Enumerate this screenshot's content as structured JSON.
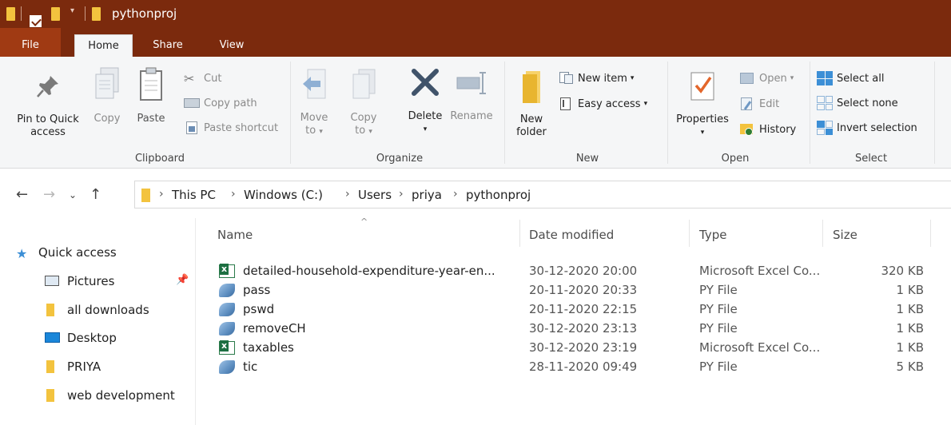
{
  "window": {
    "title": "pythonproj"
  },
  "ribbon_tabs": {
    "file": "File",
    "home": "Home",
    "share": "Share",
    "view": "View"
  },
  "clipboard": {
    "pin_label": "Pin to Quick access",
    "pin_line1": "Pin to Quick",
    "pin_line2": "access",
    "copy": "Copy",
    "paste": "Paste",
    "cut": "Cut",
    "copy_path": "Copy path",
    "paste_shortcut": "Paste shortcut",
    "group": "Clipboard"
  },
  "organize": {
    "move_to_1": "Move",
    "move_to_2": "to",
    "copy_to_1": "Copy",
    "copy_to_2": "to",
    "delete": "Delete",
    "rename": "Rename",
    "group": "Organize"
  },
  "new": {
    "folder_1": "New",
    "folder_2": "folder",
    "new_item": "New item",
    "easy_access": "Easy access",
    "group": "New"
  },
  "open": {
    "properties": "Properties",
    "open": "Open",
    "edit": "Edit",
    "history": "History",
    "group": "Open"
  },
  "select": {
    "select_all": "Select all",
    "select_none": "Select none",
    "invert": "Invert selection",
    "group": "Select"
  },
  "breadcrumb": [
    "This PC",
    "Windows (C:)",
    "Users",
    "priya",
    "pythonproj"
  ],
  "navpane": {
    "quick_access": "Quick access",
    "items": [
      "Pictures",
      "all downloads",
      "Desktop",
      "PRIYA",
      "web development"
    ]
  },
  "columns": {
    "name": "Name",
    "date": "Date modified",
    "type": "Type",
    "size": "Size"
  },
  "files": [
    {
      "name": "detailed-household-expenditure-year-en...",
      "date": "30-12-2020 20:00",
      "type": "Microsoft Excel Co...",
      "size": "320 KB",
      "icon": "excel-icon"
    },
    {
      "name": "pass",
      "date": "20-11-2020 20:33",
      "type": "PY File",
      "size": "1 KB",
      "icon": "python-icon"
    },
    {
      "name": "pswd",
      "date": "20-11-2020 22:15",
      "type": "PY File",
      "size": "1 KB",
      "icon": "python-icon"
    },
    {
      "name": "removeCH",
      "date": "30-12-2020 23:13",
      "type": "PY File",
      "size": "1 KB",
      "icon": "python-icon"
    },
    {
      "name": "taxables",
      "date": "30-12-2020 23:19",
      "type": "Microsoft Excel Co...",
      "size": "1 KB",
      "icon": "excel-icon"
    },
    {
      "name": "tic",
      "date": "28-11-2020 09:49",
      "type": "PY File",
      "size": "5 KB",
      "icon": "python-icon"
    }
  ],
  "colors": {
    "titlebar": "#7b2a0d",
    "file_tab": "#a03a13",
    "ribbon_bg": "#f5f6f7"
  }
}
